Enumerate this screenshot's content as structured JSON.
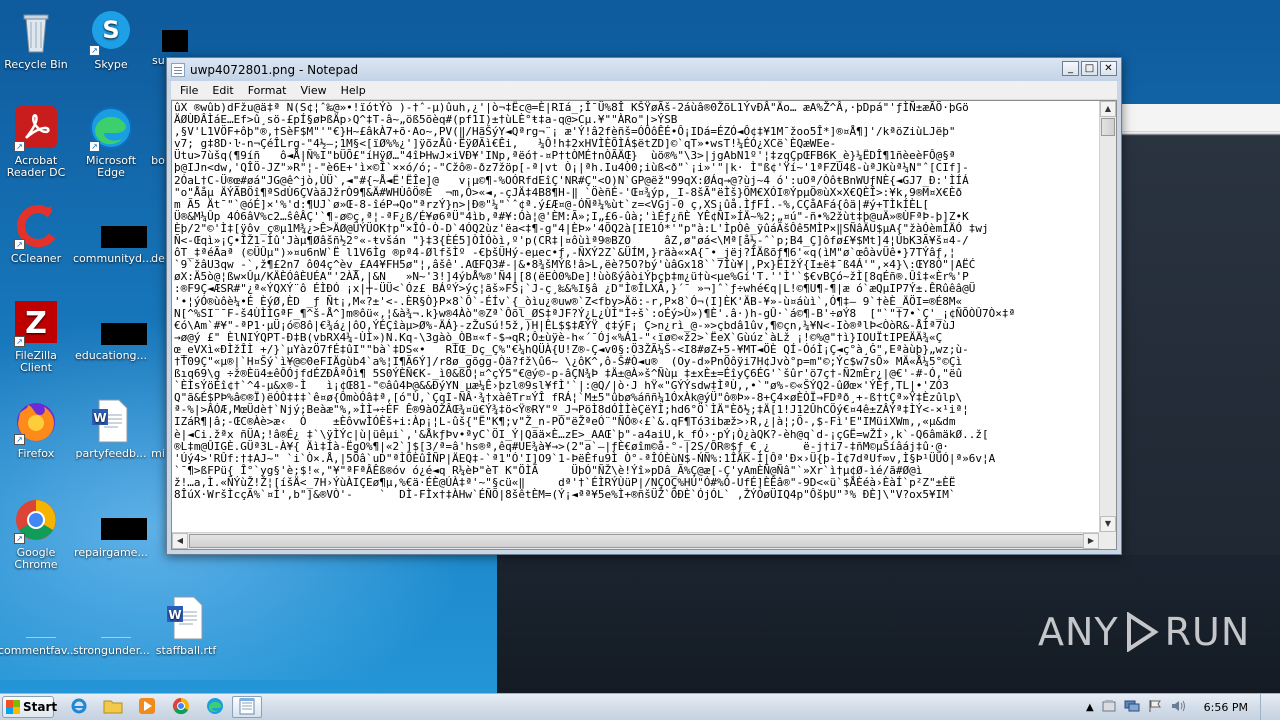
{
  "desktop": {
    "icons": [
      {
        "label": "Recycle Bin"
      },
      {
        "label": "Skype"
      },
      {
        "label": "su"
      },
      {
        "label": "Acrobat Reader DC"
      },
      {
        "label": "Microsoft Edge"
      },
      {
        "label": "bo"
      },
      {
        "label": "CCleaner"
      },
      {
        "label": "communityd..."
      },
      {
        "label": "de"
      },
      {
        "label": "FileZilla Client"
      },
      {
        "label": "educationg..."
      },
      {
        "label": "Firefox"
      },
      {
        "label": "partyfeedb..."
      },
      {
        "label": "mi"
      },
      {
        "label": "Google Chrome"
      },
      {
        "label": "repairgame..."
      },
      {
        "label": "commentfav..."
      },
      {
        "label": "strongunder..."
      },
      {
        "label": "staffball.rtf"
      }
    ]
  },
  "notepad": {
    "title": "uwp4072801.png - Notepad",
    "menu": [
      "File",
      "Edit",
      "Format",
      "View",
      "Help"
    ],
    "controls": {
      "minimize": "_",
      "maximize": "□",
      "close": "✕"
    },
    "content_lines": [
      "ûX ®wûb)dFžu@ä‡ª N(S¢¦ˆ‰@»•!ïótÝò )-†ˆ-µ)ûuh,¿'|ò¬‡Ëc@=È|RIá_;Î¯Ü%8Î KŠŸøÃš-2áùâ®0ŽõL1ÝvÐÂ\"Äo… æA%Ž^Â‚·þDpá\"'ƒÌÑ±æÃÖ·þGö",
      "ÄØÙÐÂÌáE…Ef>û¸sö-£pÍ§øÞßÄp›Q^‡T-â~„öß5õèq#(pf1I)±†ùLÈ°ŧ‡a-q@>Cµ.¥\"\"ÀRo\"|>ÝSB",
      ",§V'L1VÖF+ôþ\"®,†SèF$M\"'\"€}H~£âkÀ7+õ·Ao~,PV(‖/HãŠýY◄Qªrg¬¨¡ æ'Ý!â2fèñš=ÓÔôÊÉ•Ô¡IDá=ÉZÓ◄Ô¢‡¥1M¯žoo5Î*]®¤Å¶]'/kªöZiùLJëþ\"",
      "v7; g‡8D·ŀ-n¬ÇéÎLrg-\"4½—;1M§<[ïØ%%¿']ÿõzÅû·ËÿØÃì€Êi,   ¼Ô!h‡2xHVÌÈÕÌÁ$ëtZD]©`qT»•wsT!¼ÉÓ¿XCë`ÈQæWEe-",
      "Ütu>7ùšq(¶9íñ   ô◄Å|Ñ%I\"bÜÕ£\"íHÿØ…\"4îÞHwJ×iVÐ¥'INp,ªëó†-¤P†tÒMÉ†nÒÃÄŒ}  ùö®%\"\\3>|jgAbN1º'¦‡zqÇpŒFB6K_è}¼ËDÎ¶1ñèeèFÔ@§ª",
      "þ@IJn<dw,'QÎÖ-JZ\"»R\"¦-\"è6E+'ì×©Î`××ó/ó;-\"Cžô®-ðz7žöp[-ª|vt Ò¡|ªh.Iu4Ò0;iùß<ð\"`¡i»'\"|k· Ì\"ß¢'Ÿí~'1ªFZÚ4ß-ùªJKùª¼N\"ˆ[CIf]-",
      "2ÓaL†C-Ü®œ#øá\"JG@ê^jò,ÙÜ`,◄\"#{~Å◄Ë'ËÎe]@   v¡µ©¶-%OÓRfdEîÇ'NR#Ç\"<O)N`GP@ëž\"99qX:ØÁq→@?ùj~4 ó':uOª/ÒôŧBnWUƒNÈ{◄GJ7_Ð:'ÌÍÁ",
      "\"o\"Ååµ ÄÝÃBÖî¶ªSdÙ6ÇVàãJžrÒ9¶&Ä#WHÙôÖ®È  ¬m,Ó>«◄,-çJÄ‡4B8¶H-‖ `ÖèñÉ-'Œ¤¾ýp,_I-8šÃ\"ëÌš}ÖM€XÓI®ÝpµÖ®ùX×X€QÈÎ>:¥k,9®M¤X€Èð",
      "m Ã5 Ät¯\"`@óÉ]×'%'d:¶UJ`ø»Œ-8-îéP→Qo\"ªrzÝ}n>|Ð®\"¼\"`ˆ¢ª.ý£Æ¤@-ÓÑª¼%ùt`z=<VGj-0 ç,XS¡ûå.ÌƒFÍ.-%,CÇåAFá{ôä|#ý+TÌkÍÈL[",
      "Ü®&M¼Ûp 4Ó6âV%c2…ŝêÂÇ'`¶-ø©ç,ª¦-ªF¿ß/É¥ø6ªÜ\"4ìb,ª#¥:Óà¦@'ÈM:Ã»;I„£6-ûà;'ìÉƒ¿ñÈ YÊ¢ÑI»ÍÄ~%2;„¤ú\"-ñ•%2žùt‡þ@uÄ»®ÙFªÞ-þ]Z•K",
      "Èþ/2\"©'Ì‡[ÿôv_ç®µ1M¾¿>Ê>ÄØ@ÜÝÜOK†p\"×ÎÓ-Ò-D`4ÓQ2ùz'ëa<‡¶-g\"4|ÈÞ»'4ÕQ2à[IE1Ó*'\"p\"à:L'ÌpÒê_ÿûáÃšÔê5MÌP×‖SÑâÄU$µA{\"žàÓèmÌÄÓ ‡wj",
      "Ñ<-Œqì»¡Ç•ÎŽ1-Ìû'Jàµ¶Øâšñ½2°«-ŧvšán \"}‡3{ÈÉ5]ÒÌÓòì,º'p(CR‡|¤ôùìª9®BZO     âZ,ø\"øá<\\Mª[å½-ˆ`p;B4_Ç]ôfø£¥$Mt]4¦ÙbK3Ã¥š¤4-/",
      "ôT_‡ªéÃaª (©ÜÛµ\")»¤u6nW`Ë l1V6Ìg ®pª4-ØlfšÌº -€þšÜHý-eµec•ƒ,-ÑXÝ2Z`&ÜÍM,}räà«×A{¯•_jëj?ÎÄßõƒ¶6'«q(ìM\"ø`œôàvÜê•}7TÝâƒ,¦",
      "`9`žâU3qw -`,ž¶£2n7 ô04ç^èv_£A4¥FH5ø\"¦,âšê'.AŒFQ3#-|&•8¾šMÝß!â>L,ëè?5O?bý'ùâGx18``7Îù¥|,Px}ËIžÝ{I±ë‡¯ß4Á'\"‚×4}\\:ŒY8Ó\"|AËĆ",
      "øX:Ä5ò@¦ßw×Ûµ/KÄÈÓâÈUÉA\"'2ÀÅ,|&N   »N~'3!]4ýbÅ%®'Ñ4|[8(ëEÒ0%De]!ùòßýâòiÝþçþ‡m¿ü†ù<µe%Gí'T.''Ì'`$€vBÇó~žÌ[8qÉñ®.Ûî‡«Èr%'P",
      ":®F9Ç◄ÆSR#\"¿ª«ÝQXÝ¨ô ÉÌÐÓ ¡x|┼-ÜÜ<`Óz£ BÁºÝ>ýç¦ãš»FŠ¡`J-ç¸‰&%I§â ¿D\"Ì®ÎLXÃ,}´¯ »¬]ˆ`ƒ÷whé€q|L!©¶U¶-¶|æ ó`æQµIP7Ý±.ÊRûêâ@Ü",
      "'•¦ýÓ®ùôè¼•É ÈýØ,ÈD _ƒ Ñt¡,M«?±'<-.ÈR§Ò}P×8`Ô`-ÉÍv`{_òìu¿®uw®`Z<fby>Äö:-r,P×8`Ó¬(I]ÈK'ÄB-¥»-ù¤áùì`,Ó¶‡– 9`†èÈ_ÄÖI=®É8M«",
      "N[^%SI¨¯F-š4ÙÌÌGªF_¶^š-Å^]m®ôü«,¦&à¾¬.k}w®4Àò\"®Zª`Ôõl_ØS‡ªJF?Ý¿L¿ÙÍ\"Ì÷š`:oÉý>Ù»)¶È'.â·)h-gÛ·`á©¶-B'÷øÝ8  [\"`\"†7•`Ç'_¡¢ÑÕÒÛ7Ò×‡ª",
      "€ó\\Am`#¥\"-ªP1·µÜ¡ó©8ô|€¾á¿|ôO,ÝÉÇîàµ>Ø%-ÄÁ}-zŽuSú!5ž,)H|ÊL$$‡ÆÝŸ ¢‡ýF¡ Ç>n¿rì_@-»>çbdâ1ûv,¶©çn,¼¥N<-Iò®ªlÞ<ÒòR&-ÅÌª7ùJ",
      "→ø@ý £\" ÈlNIÝQPT-Ð‡B(vbRX4¼-ÙÌ»)N.Kq-\\3gàò_ÒB¤«f-$→qR;Ô±ùÿè-h«´¯Ój«%Á1-\"‹ïø©«ž2>`ËeX`Gùúz`àLž ¡!©%@\"†ì}IOUÏtIPEÄÄ¾«Ç",
      "œ_eVXì«ÐÌžÎÌ +/}`µYàzÖ7fÉ‡ûI\"\"bà`‡DS«•   RÌŒ_Dç_Ç%\"€¼hQÜÀ{U!Z®-Ç◄v0§:Ö3ŽÃ¼Š-<I8#øZ+5-¥MT◄ÖÈ QÍ-ÓóÌ¡Ç◄ç°à¸Ġ\"‚Eªàùþ}„wz;ù-",
      "†Ť09Ç\"«µ®|`H¤Šý`ì¥@©0eFIÄgùb4`a%¦I¶Ã6Ý]/r8ø_gõgg-Òä?fž\\û6~ \\¿ôK^,ô-Š#Ò◄u®  (Oy-d»PnÖôÿi7H¢Jvò°p=m\"©;Ýc$w7sÕ» MÄ«Å¼5°©Çì",
      "ßıq69\\g ÷ž®Èü4±êÔÓjfdÉZÐÂªÔì¶ 5S0ÝÈÑ€K-_ì0&ßÖ¦¤^çÝ5\"€@ý©-p-âÇN¾Þ ‡Ä±@À»š^Ñùµ ‡±xÈ±=ÉîyÇ6ÉG'`šûr'ö7ç†-Ñ2mÈr¿|@€'-#-Ó,\"ëû",
      "`ÈÌsÝöÉî¢†`^4-µ&x®-Ì   ì¡¢Œ81-\"©âû4Þ@&&ÐýYN µæ¼Ê›þzl®9sl¥fÌ'`|:@Q/|ò·J hŸ«\"GÝÝsdw‡ÌªÙ‚,•`\"ø%-©«ŠÝQ2-ûØœ×'ÝÈƒ,TL|•'ZÓ3",
      "Q\"ã&É$PÞ%â©®Ï)ëÓÒ‡‡‡`ê¤ø{ÔmòÓâ‡ª,[ó\"Ù‚`ÇqI-ÑÂ·¾†xàêTr¤ÝÎ fRÁ¦`M±5\"ûbø%áññ¼1ÓxÀk@ýÜ\"ô®Þ»-8+Ç4×øÈÒÏ→FDªð¸+-ß†tÇª»Ÿ‡Èzûlp\\",
      "ª-%|>ÂÓÆ,MœÜdè†`Njý;Beàæ\"%,»ÌÌ→÷ÉF Ê®9àOŽÂŒ¾¤ü€Ý¾‡ö<Ÿ®RY\"º_J¬PöÌ8dÓÌÌèÇëYÌ;hd6°Ö`ÌÄ\"Èð½;‡Ä[1!J12ÛhCÖý€¤4ê±ZÂÝª‡ÌÝ<-×¹iª¦",
      "IZáR¶|â;-ŒC®Àè>æ‹  Ó    ±ÈôvwÌÓÈš+i:Àp¡¦L-ûš{\"Ë\"K¶;v\"Ž_n-PÓ\"ëŽªeÓ¨\"ÑÓ®‹£`&.qF¶Tó3ibæž>›R,¿|à¦;Ö-,$-Fì'E\"IMüiXWm,,«µ&dm",
      "è|◄Ci.žªx ñÜA;!â®É¿ ‡`\\ÿÌÝc|ù|üêµi`,'&ÅkƒÞv•ªyC`ÖI_Ý|Qãä×È…zE>_AAŒ`þ\"-a4aiU,k_fÓ›·pÝ¡Ò¿àQK?-èh@q`d-¡çGË=wŽÍ›,k`-Q6âmäkØ..ž[",
      "®L‡m@ÛIGÈ.GÜª3L-À¥{ Äì‡Íà-ËgO%¶|«2`]$[3/ª=â'hs®ª,êq#UE¾à¥→>(2\"a`—|ƒÈ€øîm©å-°-|2S/ÕR®$ƒ_€¸¿     ë-j†i7-‡ñM©µŠíâáj‡û·@·",
      "'Úý4>'RÛf:†‡AJ~\" `i`Ò×.Å,|5Õâ`uD\"ªÌÖÈûÎÑP|ÄEQ‡-`ª1\"Ó'I]O9`1-ÞëÊfu9Ì Ò°-ªÎÓÈùN$-ŃÑ%:1ÎÄK-Ì|Ôª'Ð×›Ü{þ-Ì¢7dªUf∞v,Ì§Þ¹ÜÜÓ|ª»6v¦A",
      "`¯¶>ßFPü{ Î°`yg§'è;$!«,\"¥\"ªFªÂÊß®óv ó¿é◄q R¼èÞ\"èT K\"ÖÌÃ     ÜþÓ\"ÑŽ\\è!Ýî»pDâ_Ã%Ç@æ[-Ç'yAmÈÑ@Ñâ\"`»Xr`ì†µ¢Ø-ìé/ã#Ø@ì",
      "ž!…a,Ì.«ÑÝùŽ!Ž¦[íšÄ<_7H›ÝùÀIÇEø¶µ‚%€ä·ÉÈ@ÚÀ‡ª'~\"§cü«‖     dª'†`ÉÌRÝÙüP|/NÇOÇ%HÚ\"Ó#%Ó-UfÉ]ÈÊâ®\"-9D<«ü`$ÅÈéà›ÈàÍ`p²Z\"±ÈË",
      "8ÎúX·WršÌcçÃ%`¤Í',b\"]&®VÒ'-    `  DÌ-FÌx†‡ÀHw`ÉÑÕ|8šêtÈM=(Ý¡◄ªª¥5e%Ì+®ñšÜŽ`ÕÐÈ`ÓjÓL` ,ŽÝÓøÜIQ4p\"ÔšþU\"³% ÐÈ]\\\"V?ox5¥IM`"
    ]
  },
  "taskbar": {
    "start_label": "Start",
    "clock": "6:56 PM"
  },
  "watermark": {
    "left": "ANY",
    "right": "RUN"
  }
}
